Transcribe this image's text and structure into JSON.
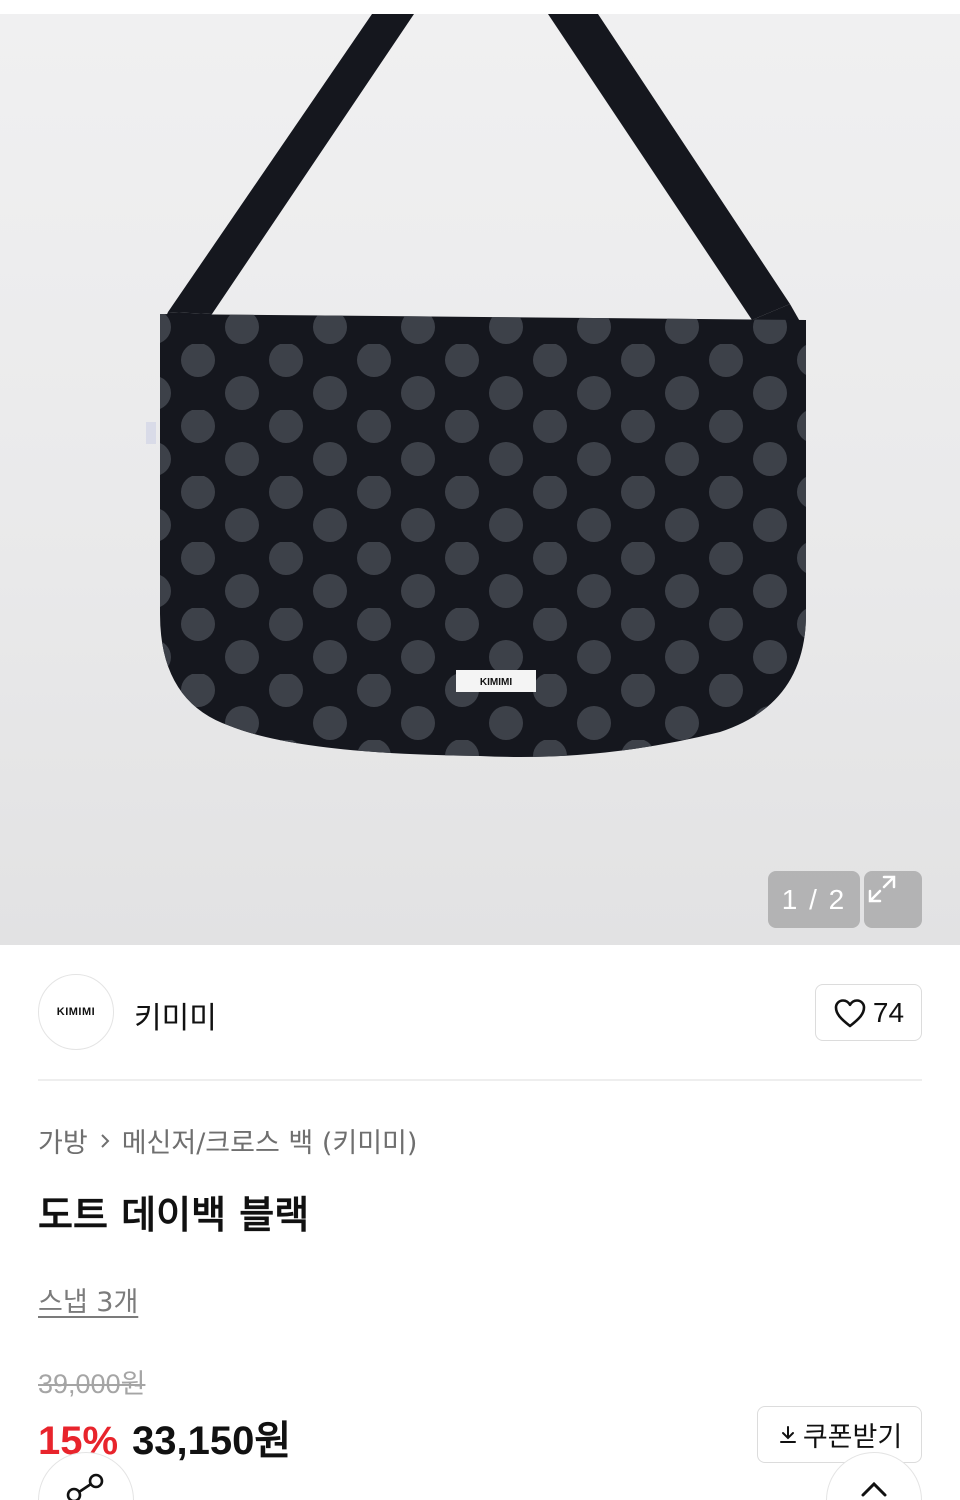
{
  "gallery": {
    "image_alt": "도트 데이백 블랙",
    "bag_label": "KIMIMI",
    "pager_text": "1 / 2",
    "colors": {
      "background": "#ebebec",
      "bag": "#15171e",
      "dots": "#3f434b"
    }
  },
  "brand": {
    "logo_text": "KIMIMI",
    "name": "키미미",
    "like_count": "74"
  },
  "breadcrumb": {
    "items": [
      "가방",
      "메신저/크로스 백 (키미미)"
    ]
  },
  "product": {
    "title": "도트 데이백 블랙",
    "snap_link": "스냅 3개",
    "original_price": "39,000원",
    "discount": "15%",
    "sale_price": "33,150원",
    "coupon_label": "쿠폰받기"
  },
  "colors": {
    "accent_red": "#e8242c",
    "text": "#111111",
    "muted": "#6f6f6f"
  },
  "icons": [
    "expand-icon",
    "heart-icon",
    "chevron-right-icon",
    "download-icon",
    "share-icon",
    "arrow-up-icon"
  ]
}
